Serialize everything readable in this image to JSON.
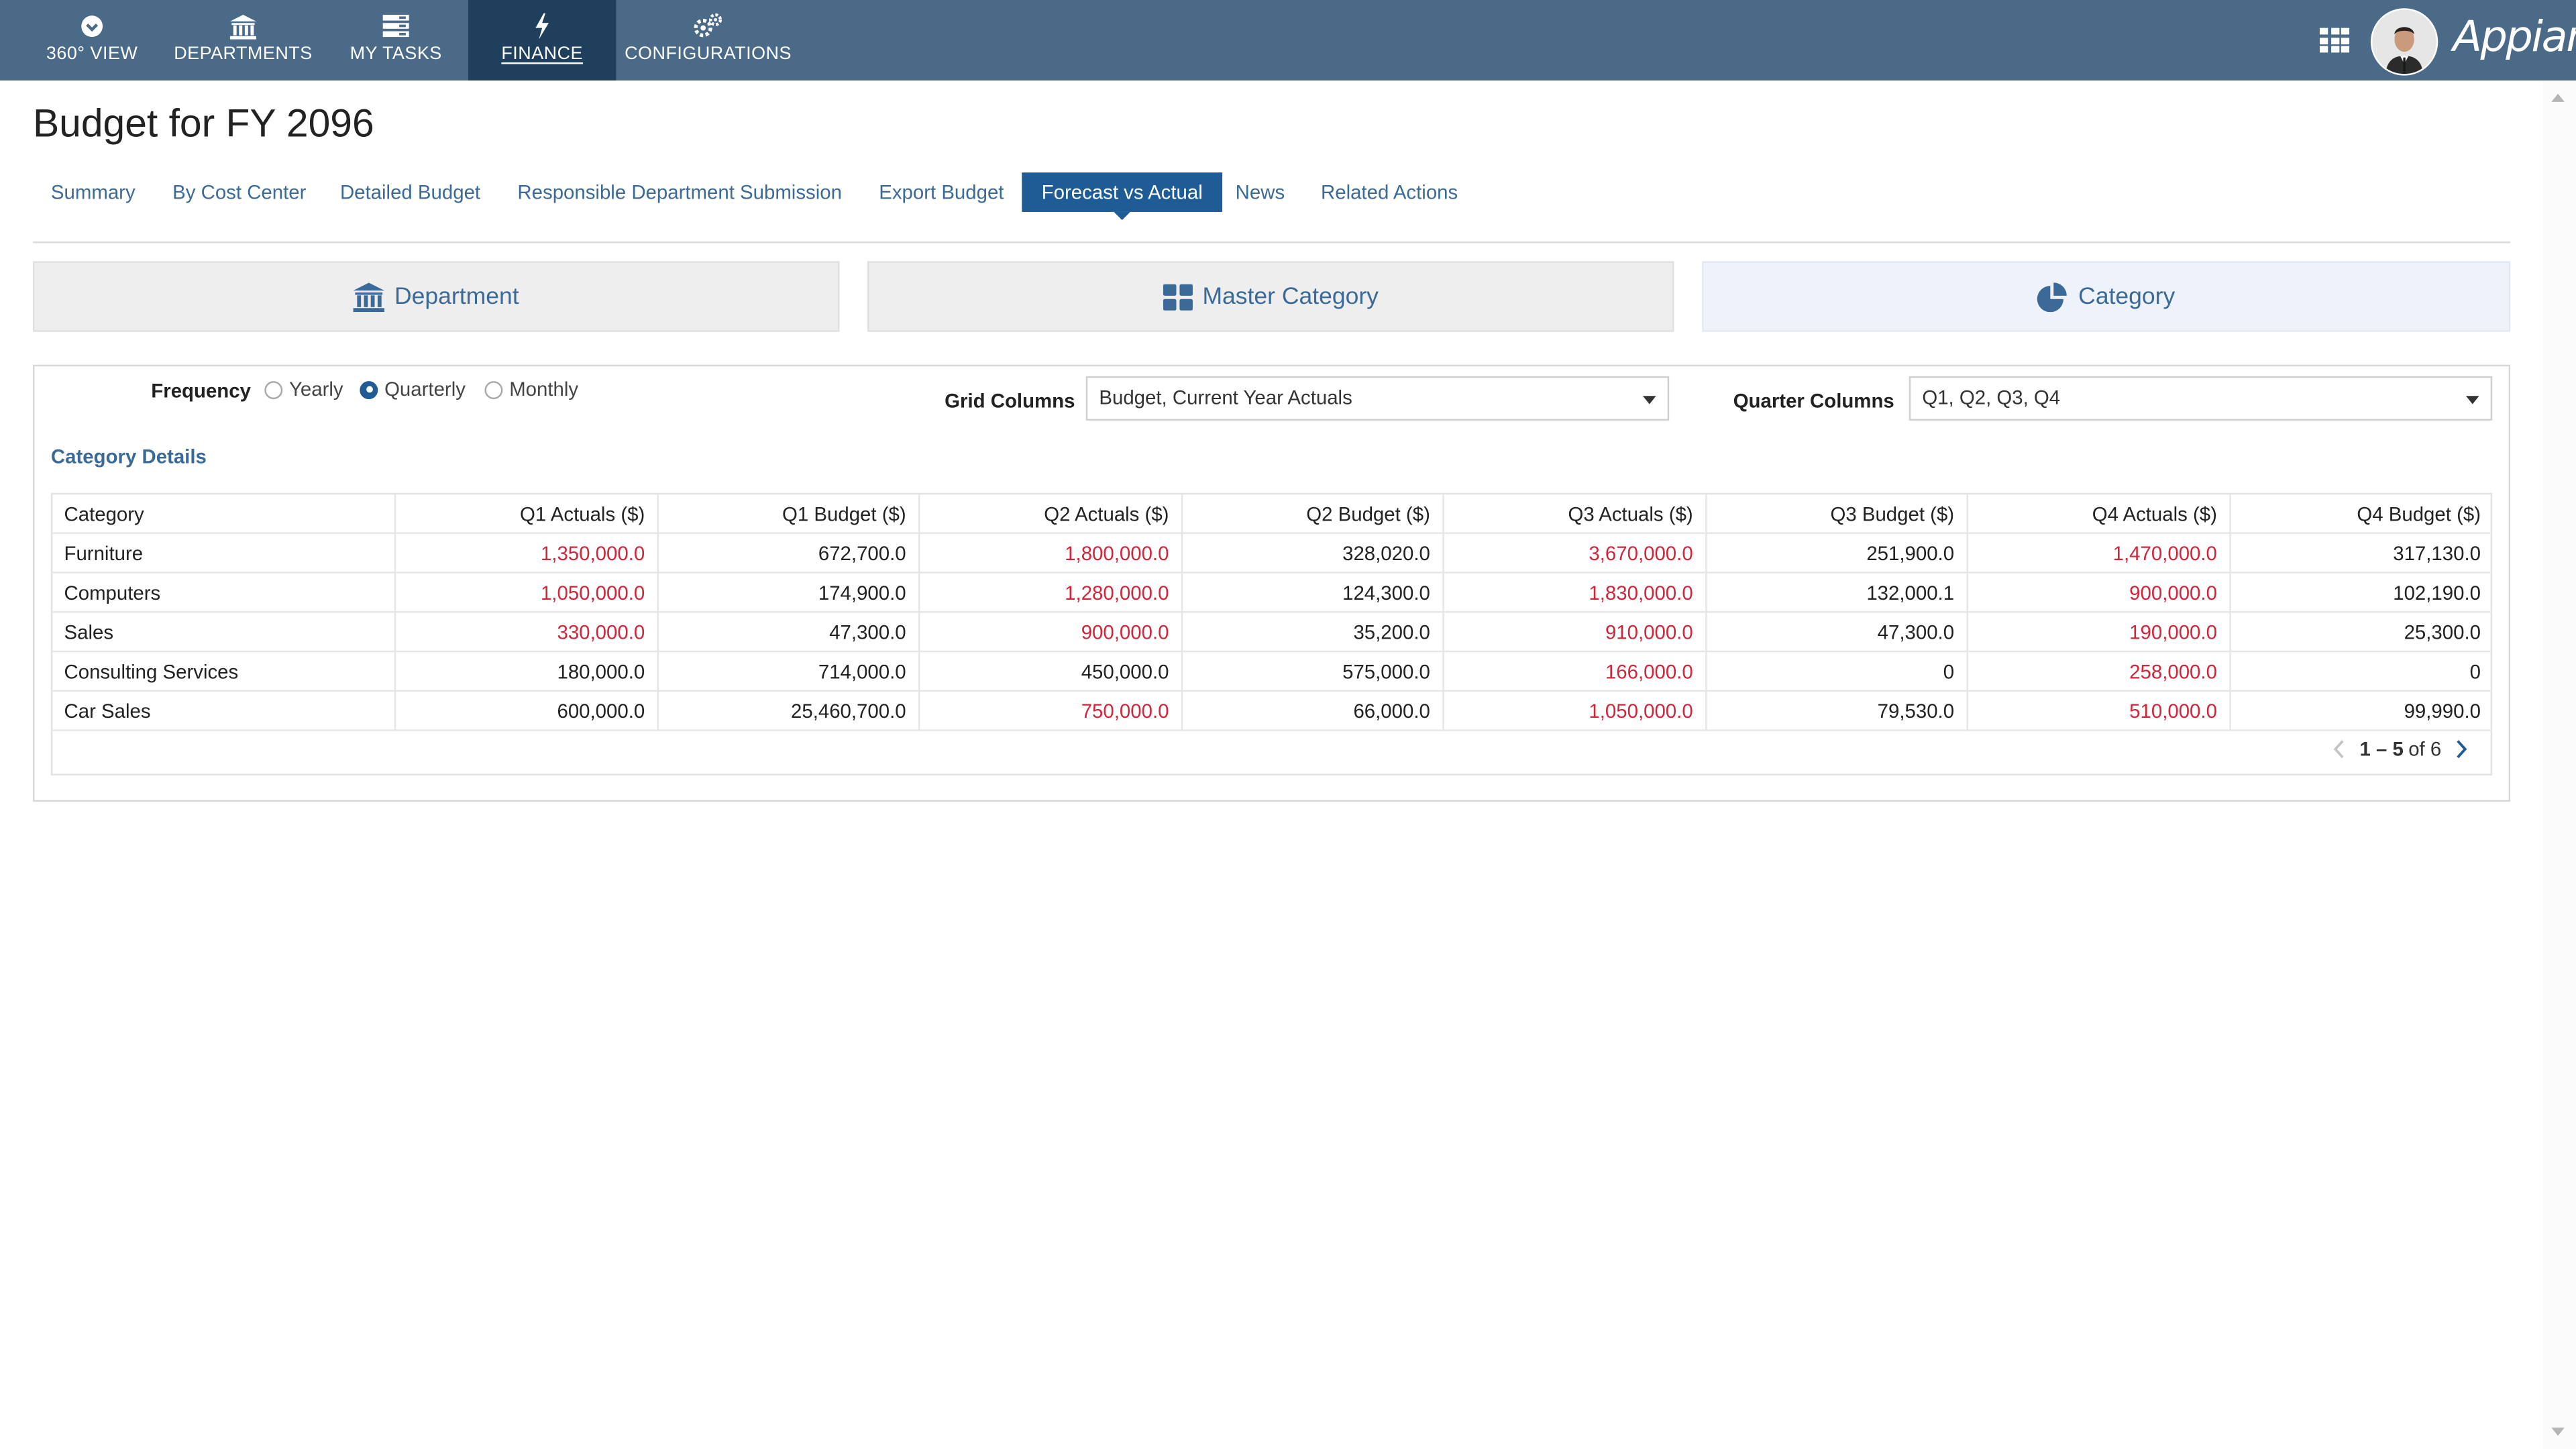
{
  "nav": {
    "items": [
      {
        "label": "360° VIEW",
        "icon": "chevron-circle-down-icon"
      },
      {
        "label": "DEPARTMENTS",
        "icon": "bank-icon"
      },
      {
        "label": "MY TASKS",
        "icon": "tasks-icon"
      },
      {
        "label": "FINANCE",
        "icon": "bolt-icon"
      },
      {
        "label": "CONFIGURATIONS",
        "icon": "gears-icon"
      }
    ],
    "active_index": 3,
    "brand": "Appian",
    "bar_color": "#4a6a88",
    "active_color": "#1f3f5c"
  },
  "page": {
    "title": "Budget for FY 2096",
    "tabs": [
      "Summary",
      "By Cost Center",
      "Detailed Budget",
      "Responsible Department Submission",
      "Export Budget",
      "Forecast vs Actual",
      "News",
      "Related Actions"
    ],
    "active_tab": "Forecast vs Actual"
  },
  "cards": [
    {
      "label": "Department",
      "icon": "bank-icon"
    },
    {
      "label": "Master Category",
      "icon": "th-large-icon"
    },
    {
      "label": "Category",
      "icon": "pie-chart-icon",
      "selected": true
    }
  ],
  "filters": {
    "frequency_label": "Frequency",
    "frequency_options": [
      "Yearly",
      "Quarterly",
      "Monthly"
    ],
    "frequency_selected": "Quarterly",
    "grid_columns_label": "Grid Columns",
    "grid_columns_value": "Budget, Current Year Actuals",
    "quarter_columns_label": "Quarter Columns",
    "quarter_columns_value": "Q1, Q2, Q3, Q4"
  },
  "table": {
    "title": "Category Details",
    "columns": [
      "Category",
      "Q1 Actuals ($)",
      "Q1 Budget ($)",
      "Q2 Actuals ($)",
      "Q2 Budget ($)",
      "Q3 Actuals ($)",
      "Q3 Budget ($)",
      "Q4 Actuals ($)",
      "Q4 Budget ($)"
    ],
    "rows": [
      {
        "cells": [
          "Furniture",
          "1,350,000.0",
          "672,700.0",
          "1,800,000.0",
          "328,020.0",
          "3,670,000.0",
          "251,900.0",
          "1,470,000.0",
          "317,130.0"
        ],
        "over": [
          1,
          3,
          5,
          7
        ]
      },
      {
        "cells": [
          "Computers",
          "1,050,000.0",
          "174,900.0",
          "1,280,000.0",
          "124,300.0",
          "1,830,000.0",
          "132,000.1",
          "900,000.0",
          "102,190.0"
        ],
        "over": [
          1,
          3,
          5,
          7
        ]
      },
      {
        "cells": [
          "Sales",
          "330,000.0",
          "47,300.0",
          "900,000.0",
          "35,200.0",
          "910,000.0",
          "47,300.0",
          "190,000.0",
          "25,300.0"
        ],
        "over": [
          1,
          3,
          5,
          7
        ]
      },
      {
        "cells": [
          "Consulting Services",
          "180,000.0",
          "714,000.0",
          "450,000.0",
          "575,000.0",
          "166,000.0",
          "0",
          "258,000.0",
          "0"
        ],
        "over": [
          5,
          7
        ]
      },
      {
        "cells": [
          "Car Sales",
          "600,000.0",
          "25,460,700.0",
          "750,000.0",
          "66,000.0",
          "1,050,000.0",
          "79,530.0",
          "510,000.0",
          "99,990.0"
        ],
        "over": [
          3,
          5,
          7
        ]
      }
    ],
    "pager": {
      "range": "1 – 5",
      "of_text": "of 6"
    },
    "over_budget_color": "#d0253a"
  }
}
